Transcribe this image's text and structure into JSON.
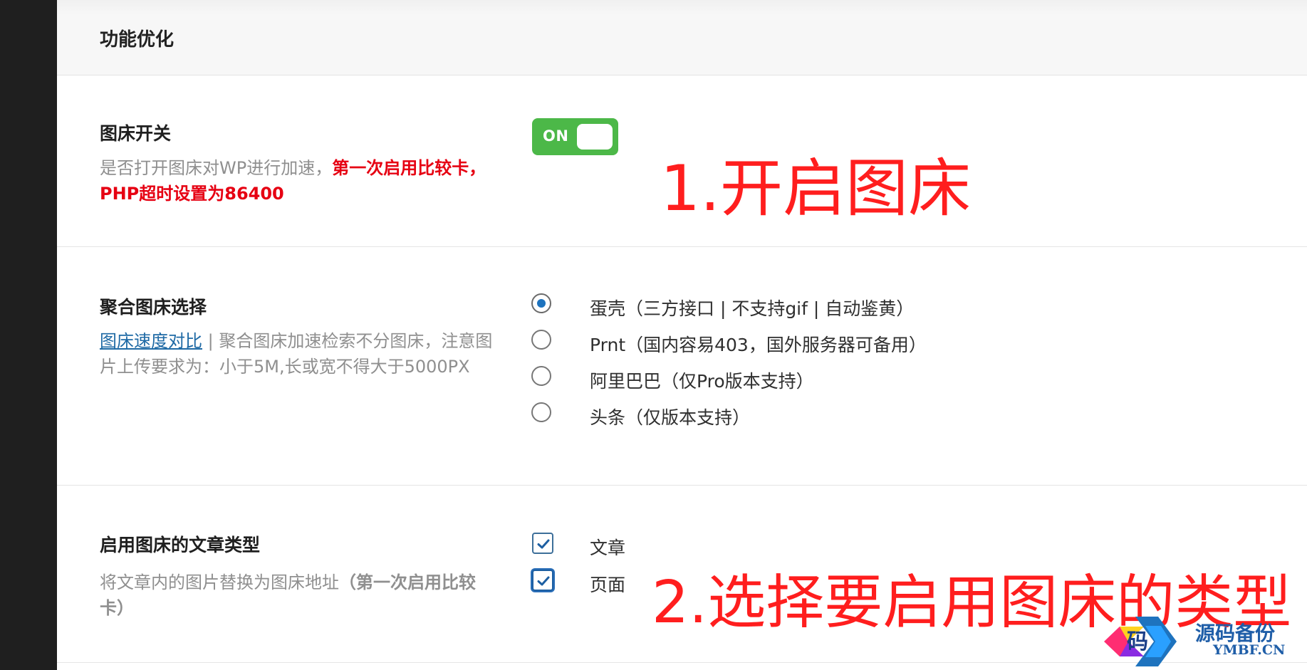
{
  "section": {
    "title": "功能优化"
  },
  "toggle_row": {
    "label": "图床开关",
    "desc_prefix": "是否打开图床对WP进行加速，",
    "desc_warning": "第一次启用比较卡，PHP超时设置为86400",
    "toggle_text": "ON",
    "state": "on"
  },
  "provider_row": {
    "label": "聚合图床选择",
    "link_text": "图床速度对比",
    "desc_rest": " | 聚合图床加速检索不分图床，注意图片上传要求为：小于5M,长或宽不得大于5000PX",
    "options": [
      {
        "label": "蛋壳（三方接口 | 不支持gif | 自动鉴黄）",
        "checked": true
      },
      {
        "label": "Prnt（国内容易403，国外服务器可备用）",
        "checked": false
      },
      {
        "label": "阿里巴巴（仅Pro版本支持）",
        "checked": false
      },
      {
        "label": "头条（仅版本支持）",
        "checked": false
      }
    ]
  },
  "post_types_row": {
    "label": "启用图床的文章类型",
    "desc_prefix": "将文章内的图片替换为图床地址",
    "desc_note": "（第一次启用比较卡）",
    "options": [
      {
        "label": "文章",
        "checked": true
      },
      {
        "label": "页面",
        "checked": true
      }
    ]
  },
  "annotations": {
    "step1": "1.开启图床",
    "step2": "2.选择要启用图床的类型"
  },
  "watermark": {
    "cn": "源码备份",
    "en": "YMBF.CN",
    "logo_char": "码"
  },
  "colors": {
    "rail": "#1f1f1f",
    "toggle_on": "#4cb848",
    "radio_checked": "#1e73be",
    "checkbox_border": "#1d5fa2",
    "link": "#1f6aa5",
    "annotation": "#ff1e1e",
    "warning": "#e60012"
  },
  "icons": {
    "radio": "radio-icon",
    "checkbox": "checkbox-icon",
    "check": "check-icon",
    "watermark": "watermark-logo-icon"
  }
}
